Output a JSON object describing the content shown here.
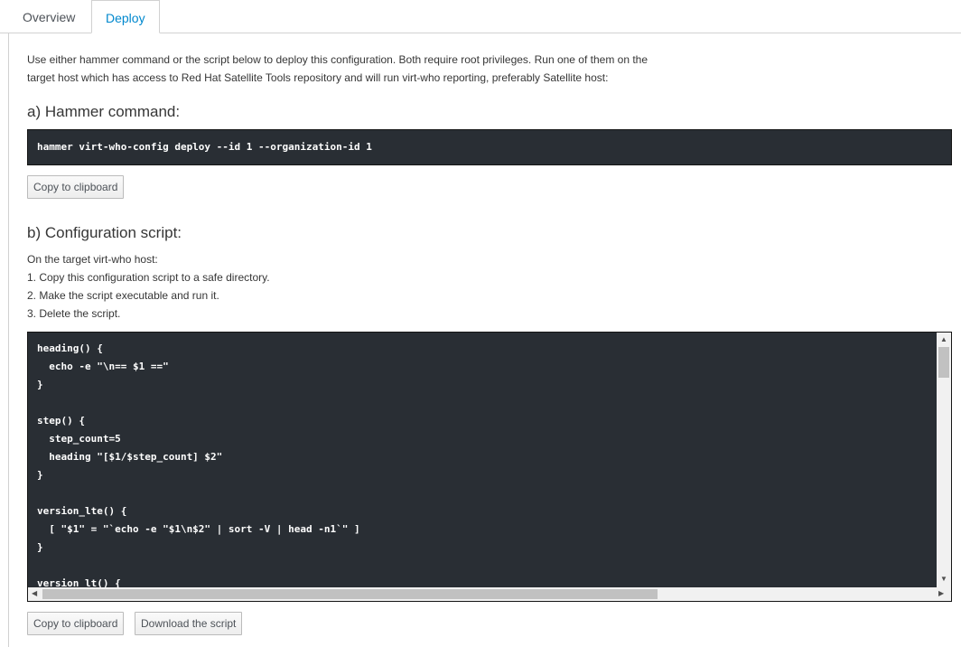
{
  "tabs": [
    {
      "label": "Overview",
      "active": false
    },
    {
      "label": "Deploy",
      "active": true
    }
  ],
  "intro": {
    "line1": "Use either hammer command or the script below to deploy this configuration. Both require root privileges. Run one of them on the",
    "line2": "target host which has access to Red Hat Satellite Tools repository and will run virt-who reporting, preferably Satellite host:"
  },
  "hammer": {
    "heading": "a) Hammer command:",
    "command": "hammer virt-who-config deploy --id 1 --organization-id 1",
    "copy_label": "Copy to clipboard"
  },
  "script": {
    "heading": "b) Configuration script:",
    "steps": [
      "On the target virt-who host:",
      "1. Copy this configuration script to a safe directory.",
      "2. Make the script executable and run it.",
      "3. Delete the script."
    ],
    "lines": [
      "heading() {",
      "  echo -e \"\\n== $1 ==\"",
      "}",
      "",
      "step() {",
      "  step_count=5",
      "  heading \"[$1/$step_count] $2\"",
      "}",
      "",
      "version_lte() {",
      "  [ \"$1\" = \"`echo -e \"$1\\n$2\" | sort -V | head -n1`\" ]",
      "}",
      "",
      "version_lt() {"
    ],
    "copy_label": "Copy to clipboard",
    "download_label": "Download the script"
  },
  "colors": {
    "accent": "#0088ce",
    "code_bg": "#292e34"
  }
}
